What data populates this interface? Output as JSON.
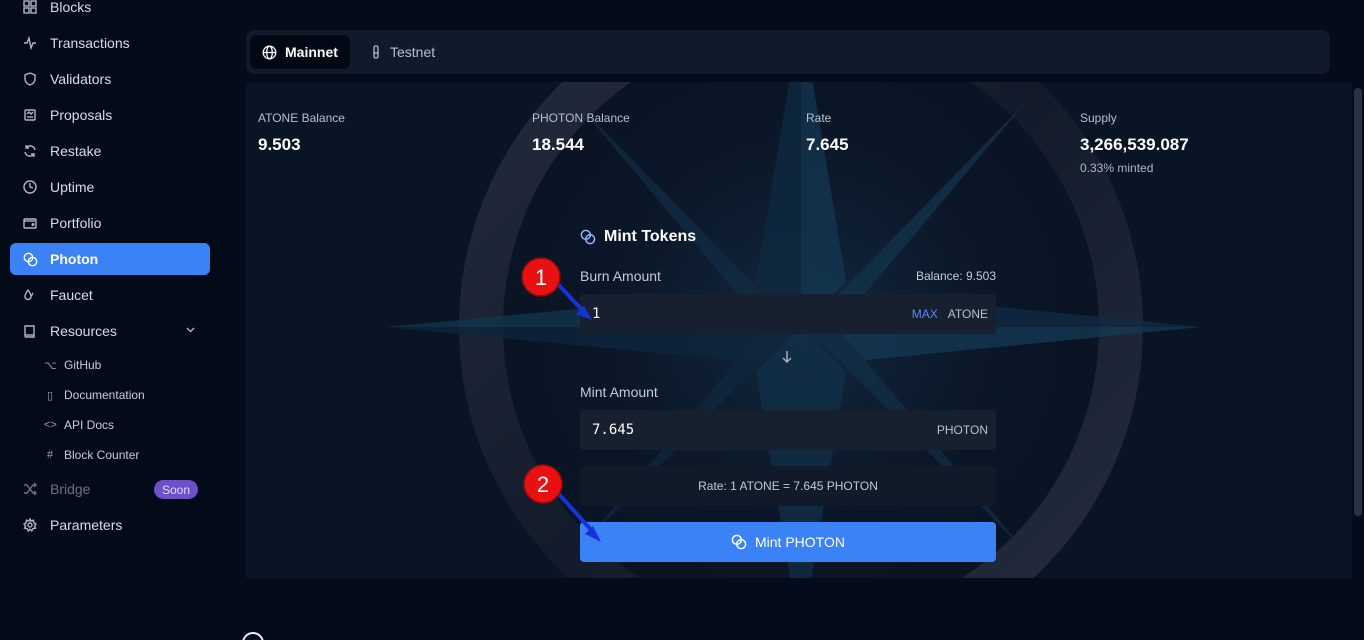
{
  "sidebar": {
    "items": [
      {
        "label": "Blocks",
        "icon": "blocks-icon"
      },
      {
        "label": "Transactions",
        "icon": "activity-icon"
      },
      {
        "label": "Validators",
        "icon": "shield-icon"
      },
      {
        "label": "Proposals",
        "icon": "proposals-icon"
      },
      {
        "label": "Restake",
        "icon": "refresh-icon"
      },
      {
        "label": "Uptime",
        "icon": "clock-icon"
      },
      {
        "label": "Portfolio",
        "icon": "wallet-icon"
      },
      {
        "label": "Photon",
        "icon": "coins-icon"
      },
      {
        "label": "Faucet",
        "icon": "droplets-icon"
      },
      {
        "label": "Resources",
        "icon": "book-icon"
      }
    ],
    "sub_items": [
      {
        "label": "GitHub",
        "icon": "github-icon"
      },
      {
        "label": "Documentation",
        "icon": "book-icon"
      },
      {
        "label": "API Docs",
        "icon": "code-icon"
      },
      {
        "label": "Block Counter",
        "icon": "hash-icon"
      }
    ],
    "bridge": {
      "label": "Bridge",
      "badge": "Soon",
      "icon": "shuffle-icon"
    },
    "parameters": {
      "label": "Parameters",
      "icon": "gear-icon"
    },
    "active": "Photon"
  },
  "network": {
    "tabs": [
      {
        "label": "Mainnet",
        "icon": "globe-icon"
      },
      {
        "label": "Testnet",
        "icon": "flask-icon"
      }
    ],
    "selected": "Mainnet"
  },
  "stats": [
    {
      "label": "ATONE Balance",
      "value": "9.503"
    },
    {
      "label": "PHOTON Balance",
      "value": "18.544"
    },
    {
      "label": "Rate",
      "value": "7.645"
    },
    {
      "label": "Supply",
      "value": "3,266,539.087",
      "sub": "0.33% minted"
    }
  ],
  "mint": {
    "title": "Mint Tokens",
    "burn_label": "Burn Amount",
    "balance": "Balance: 9.503",
    "burn_value": "1",
    "max_label": "MAX",
    "burn_unit": "ATONE",
    "mint_label": "Mint Amount",
    "mint_value": "7.645",
    "mint_unit": "PHOTON",
    "rate_text": "Rate: 1 ATONE = 7.645 PHOTON",
    "button_label": "Mint PHOTON"
  },
  "annotations": [
    {
      "number": "1"
    },
    {
      "number": "2"
    }
  ],
  "colors": {
    "accent": "#3b82f6",
    "annotation": "#e81010",
    "arrow": "#1433d8"
  }
}
